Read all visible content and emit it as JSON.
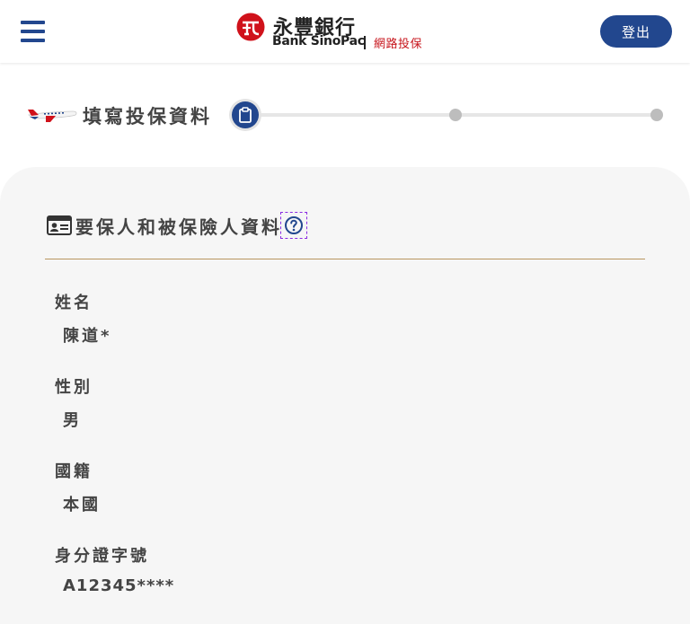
{
  "header": {
    "menu_icon": "hamburger-menu-icon",
    "brand_cn": "永豐銀行",
    "brand_en": "Bank SinoPac",
    "brand_sub": "網路投保",
    "brand_color": "#c7161d",
    "logout_label": "登出",
    "accent": "#22478e"
  },
  "steps": {
    "title": "填寫投保資料",
    "current": 1,
    "total": 3
  },
  "section": {
    "title": "要保人和被保險人資料",
    "help_icon": "question-circle-icon"
  },
  "fields": [
    {
      "label": "姓名",
      "value": "陳道*"
    },
    {
      "label": "性別",
      "value": "男"
    },
    {
      "label": "國籍",
      "value": "本國"
    },
    {
      "label": "身分證字號",
      "value": "A12345****"
    }
  ]
}
